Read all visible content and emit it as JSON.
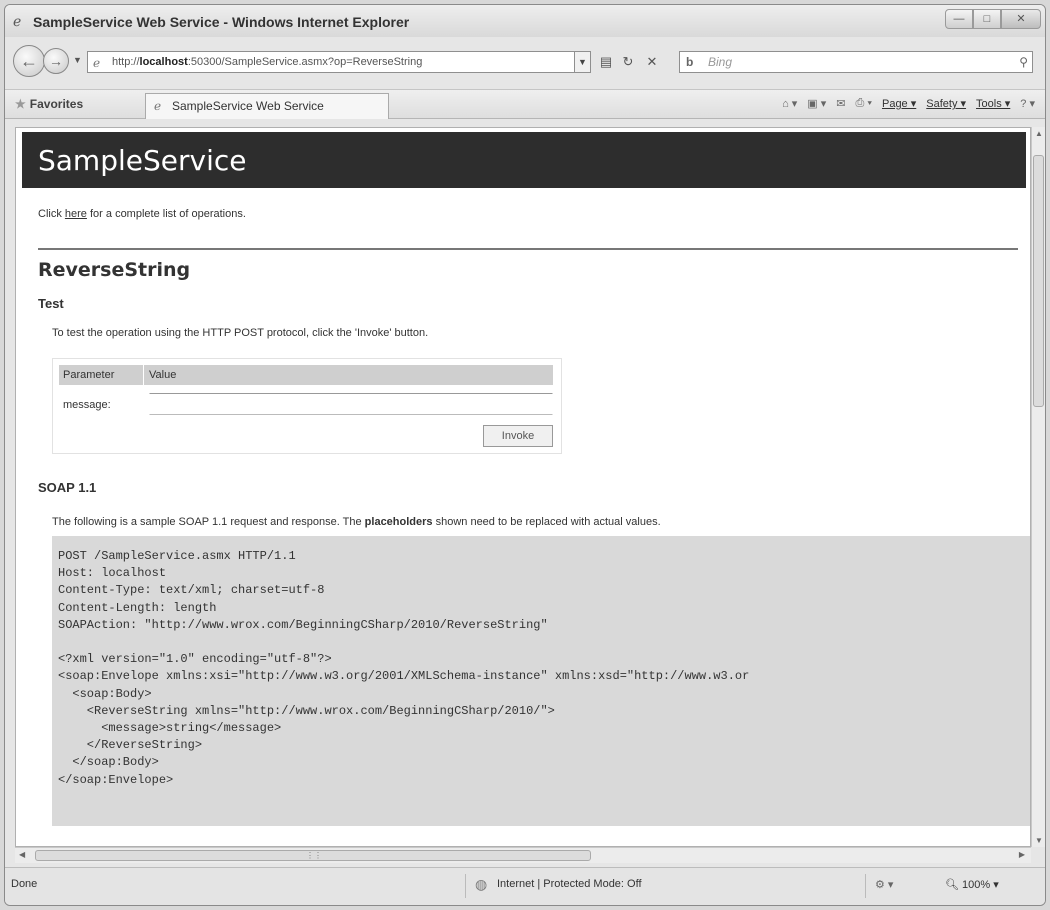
{
  "window": {
    "title": "SampleService Web Service - Windows Internet Explorer",
    "min_label": "▭",
    "max_label": "▢",
    "close_label": "✕"
  },
  "navbar": {
    "back_glyph": "←",
    "forward_glyph": "→",
    "address_prefix": "http://",
    "address_host": "localhost",
    "address_rest": ":50300/SampleService.asmx?op=ReverseString",
    "search_engine": "b",
    "search_placeholder": "Bing"
  },
  "favorites": {
    "label": "Favorites",
    "tab_title": "SampleService Web Service",
    "commands": [
      "Page ▾",
      "Safety ▾",
      "Tools ▾"
    ]
  },
  "page": {
    "banner": "SampleService",
    "intro_prefix": "Click",
    "intro_link": "here",
    "intro_suffix": "for a complete list of operations.",
    "operation_title": "ReverseString",
    "test_heading": "Test",
    "test_text": "To test the operation using the HTTP POST protocol, click the 'Invoke' button.",
    "param_header": "Parameter",
    "value_header": "Value",
    "param_name": "message:",
    "param_value": "",
    "invoke_label": "Invoke",
    "soap_heading": "SOAP 1.1",
    "soap_text_prefix": "The following is a sample SOAP 1.1 request and response. The",
    "soap_text_bold": "placeholders",
    "soap_text_suffix": "shown need to be replaced with actual values.",
    "code_lines": [
      "POST /SampleService.asmx HTTP/1.1",
      "Host: localhost",
      "Content-Type: text/xml; charset=utf-8",
      "Content-Length: length",
      "SOAPAction: \"http://www.wrox.com/BeginningCSharp/2010/ReverseString\"",
      "",
      "<?xml version=\"1.0\" encoding=\"utf-8\"?>",
      "<soap:Envelope xmlns:xsi=\"http://www.w3.org/2001/XMLSchema-instance\" xmlns:xsd=\"http://www.w3.or",
      "  <soap:Body>",
      "    <ReverseString xmlns=\"http://www.wrox.com/BeginningCSharp/2010/\">",
      "      <message>string</message>",
      "    </ReverseString>",
      "  </soap:Body>",
      "</soap:Envelope>"
    ]
  },
  "statusbar": {
    "status": "Done",
    "zone": "Internet | Protected Mode: Off",
    "zoom": "100%"
  }
}
